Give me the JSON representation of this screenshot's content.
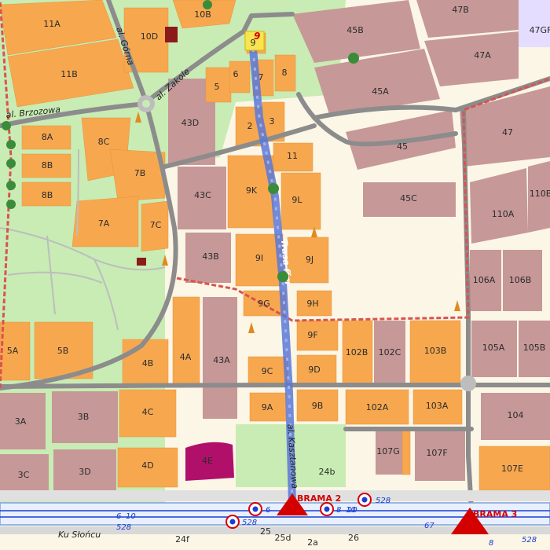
{
  "buildings": [
    {
      "id": "b-11a",
      "label": "11A"
    },
    {
      "id": "b-11b",
      "label": "11B"
    },
    {
      "id": "b-10d",
      "label": "10D"
    },
    {
      "id": "b-10b",
      "label": "10B"
    },
    {
      "id": "b-9",
      "label": "9"
    },
    {
      "id": "b-5",
      "label": "5"
    },
    {
      "id": "b-6",
      "label": "6"
    },
    {
      "id": "b-7",
      "label": "7"
    },
    {
      "id": "b-8",
      "label": "8"
    },
    {
      "id": "b-2",
      "label": "2"
    },
    {
      "id": "b-3",
      "label": "3"
    },
    {
      "id": "b-43d",
      "label": "43D"
    },
    {
      "id": "b-8a",
      "label": "8A"
    },
    {
      "id": "b-8b",
      "label": "8B"
    },
    {
      "id": "b-8b2",
      "label": "8B"
    },
    {
      "id": "b-8c",
      "label": "8C"
    },
    {
      "id": "b-7b",
      "label": "7B"
    },
    {
      "id": "b-7a",
      "label": "7A"
    },
    {
      "id": "b-7c",
      "label": "7C"
    },
    {
      "id": "b-43c",
      "label": "43C"
    },
    {
      "id": "b-43b",
      "label": "43B"
    },
    {
      "id": "b-11",
      "label": "11"
    },
    {
      "id": "b-9k",
      "label": "9K"
    },
    {
      "id": "b-9l",
      "label": "9L"
    },
    {
      "id": "b-9i",
      "label": "9I"
    },
    {
      "id": "b-9j",
      "label": "9J"
    },
    {
      "id": "b-9g",
      "label": "9G"
    },
    {
      "id": "b-9h",
      "label": "9H"
    },
    {
      "id": "b-9f",
      "label": "9F"
    },
    {
      "id": "b-9c",
      "label": "9C"
    },
    {
      "id": "b-9d",
      "label": "9D"
    },
    {
      "id": "b-9a",
      "label": "9A"
    },
    {
      "id": "b-9b",
      "label": "9B"
    },
    {
      "id": "b-43a",
      "label": "43A"
    },
    {
      "id": "b-5a",
      "label": "5A"
    },
    {
      "id": "b-5b",
      "label": "5B"
    },
    {
      "id": "b-4b",
      "label": "4B"
    },
    {
      "id": "b-4a",
      "label": "4A"
    },
    {
      "id": "b-4c",
      "label": "4C"
    },
    {
      "id": "b-3a",
      "label": "3A"
    },
    {
      "id": "b-3b",
      "label": "3B"
    },
    {
      "id": "b-3c",
      "label": "3C"
    },
    {
      "id": "b-3d",
      "label": "3D"
    },
    {
      "id": "b-4d",
      "label": "4D"
    },
    {
      "id": "b-4e",
      "label": "4E"
    },
    {
      "id": "b-45b",
      "label": "45B"
    },
    {
      "id": "b-47b",
      "label": "47B"
    },
    {
      "id": "b-47gf",
      "label": "47GF"
    },
    {
      "id": "b-47a",
      "label": "47A"
    },
    {
      "id": "b-45a",
      "label": "45A"
    },
    {
      "id": "b-45",
      "label": "45"
    },
    {
      "id": "b-47",
      "label": "47"
    },
    {
      "id": "b-45c",
      "label": "45C"
    },
    {
      "id": "b-110b",
      "label": "110B"
    },
    {
      "id": "b-110a",
      "label": "110A"
    },
    {
      "id": "b-106a",
      "label": "106A"
    },
    {
      "id": "b-106b",
      "label": "106B"
    },
    {
      "id": "b-102b",
      "label": "102B"
    },
    {
      "id": "b-102c",
      "label": "102C"
    },
    {
      "id": "b-103b",
      "label": "103B"
    },
    {
      "id": "b-105a",
      "label": "105A"
    },
    {
      "id": "b-105b",
      "label": "105B"
    },
    {
      "id": "b-102a",
      "label": "102A"
    },
    {
      "id": "b-103a",
      "label": "103A"
    },
    {
      "id": "b-104",
      "label": "104"
    },
    {
      "id": "b-107g",
      "label": "107G"
    },
    {
      "id": "b-107f",
      "label": "107F"
    },
    {
      "id": "b-107e",
      "label": "107E"
    },
    {
      "id": "b-24b",
      "label": "24b"
    },
    {
      "id": "b-24f",
      "label": "24f"
    },
    {
      "id": "b-25",
      "label": "25"
    },
    {
      "id": "b-25d",
      "label": "25d"
    },
    {
      "id": "b-2a",
      "label": "2a"
    },
    {
      "id": "b-26",
      "label": "26"
    }
  ],
  "streets": {
    "gorna": "al. Górna",
    "zakole": "al. Zakole",
    "brzozowa": "al. Brzozowa",
    "kasztanowa": "al. Kasztanowa",
    "slonca": "Ku Słońcu"
  },
  "route": {
    "label": "Trasa ffm",
    "marker": "9",
    "color": "#5a78d6"
  },
  "gates": [
    {
      "label": "BRAMA 2"
    },
    {
      "label": "BRAMA 3"
    }
  ],
  "bus_lines": [
    "6",
    "10",
    "528",
    "6",
    "10",
    "528",
    "528",
    "8",
    "10",
    "67",
    "528",
    "8"
  ],
  "colors": {
    "building": "#f7a84f",
    "park": "#c8ecb4",
    "road": "#8c8c8c",
    "residential": "#c79898",
    "path": "#d9534f",
    "special": "#b0106a"
  }
}
